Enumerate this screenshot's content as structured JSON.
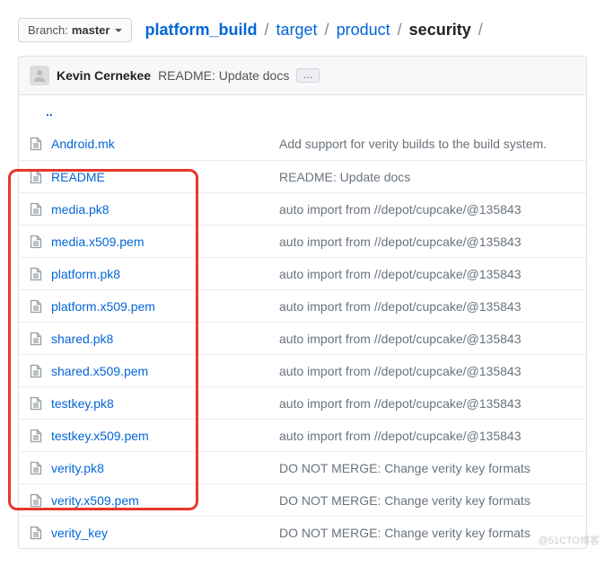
{
  "branch": {
    "label": "Branch:",
    "name": "master"
  },
  "breadcrumb": {
    "root": "platform_build",
    "parts": [
      "target",
      "product"
    ],
    "current": "security"
  },
  "commit": {
    "author": "Kevin Cernekee",
    "message": "README: Update docs",
    "ellipsis": "…"
  },
  "uplink": "..",
  "files": [
    {
      "name": "Android.mk",
      "msg": "Add support for verity builds to the build system.",
      "hl": false
    },
    {
      "name": "README",
      "msg": "README: Update docs",
      "hl": false
    },
    {
      "name": "media.pk8",
      "msg": "auto import from //depot/cupcake/@135843",
      "hl": true
    },
    {
      "name": "media.x509.pem",
      "msg": "auto import from //depot/cupcake/@135843",
      "hl": true
    },
    {
      "name": "platform.pk8",
      "msg": "auto import from //depot/cupcake/@135843",
      "hl": true
    },
    {
      "name": "platform.x509.pem",
      "msg": "auto import from //depot/cupcake/@135843",
      "hl": true
    },
    {
      "name": "shared.pk8",
      "msg": "auto import from //depot/cupcake/@135843",
      "hl": true
    },
    {
      "name": "shared.x509.pem",
      "msg": "auto import from //depot/cupcake/@135843",
      "hl": true
    },
    {
      "name": "testkey.pk8",
      "msg": "auto import from //depot/cupcake/@135843",
      "hl": true
    },
    {
      "name": "testkey.x509.pem",
      "msg": "auto import from //depot/cupcake/@135843",
      "hl": true
    },
    {
      "name": "verity.pk8",
      "msg": "DO NOT MERGE: Change verity key formats",
      "hl": true
    },
    {
      "name": "verity.x509.pem",
      "msg": "DO NOT MERGE: Change verity key formats",
      "hl": true
    },
    {
      "name": "verity_key",
      "msg": "DO NOT MERGE: Change verity key formats",
      "hl": true
    }
  ],
  "watermark": "@51CTO博客"
}
